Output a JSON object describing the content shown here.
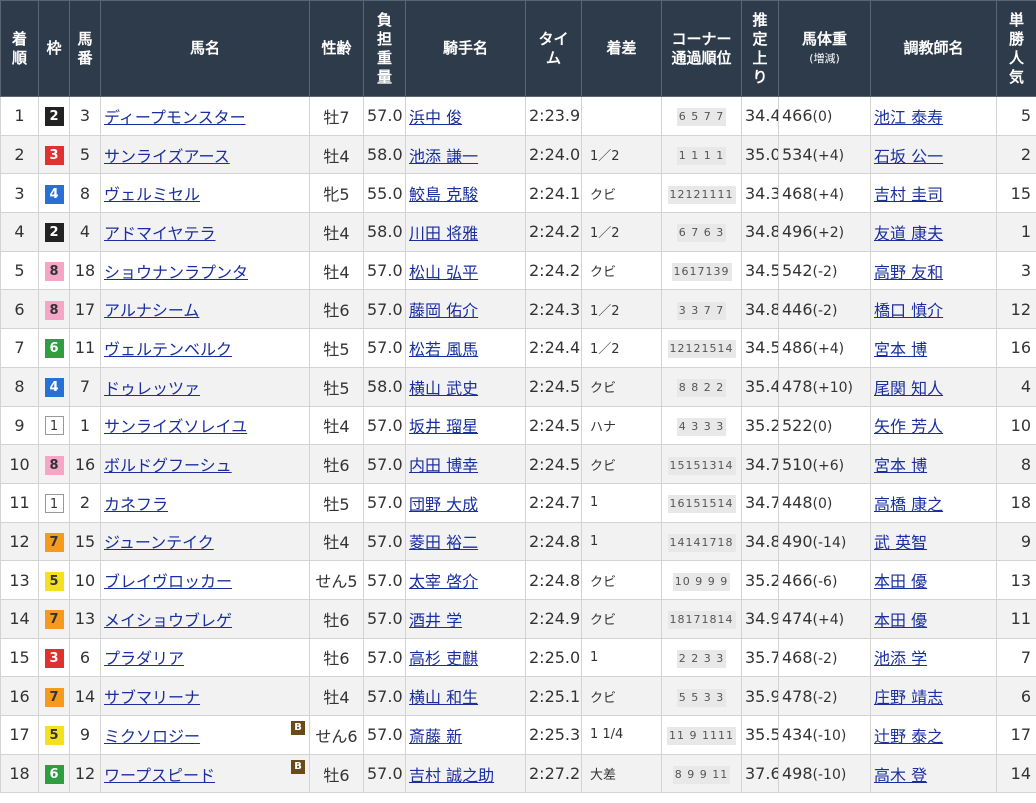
{
  "headers": {
    "rank": [
      "着",
      "順"
    ],
    "waku": "枠",
    "umaban": [
      "馬",
      "番"
    ],
    "horse": "馬名",
    "sexage": "性齢",
    "weight": [
      "負",
      "担",
      "重",
      "量"
    ],
    "jockey": "騎手名",
    "time": [
      "タイ",
      "ム"
    ],
    "margin": "着差",
    "corner": [
      "コーナー",
      "通過順位"
    ],
    "last3f": [
      "推",
      "定",
      "上",
      "り"
    ],
    "body": "馬体重",
    "body_sub": "(増減)",
    "trainer": "調教師名",
    "pop": [
      "単",
      "勝",
      "人",
      "気"
    ]
  },
  "colors": {
    "header_bg": "#2e3b4a",
    "link": "#1a2ea0",
    "waku": {
      "1": "#ffffff",
      "2": "#222222",
      "3": "#e03030",
      "4": "#2a6fd6",
      "5": "#f5e020",
      "6": "#2e9e40",
      "7": "#f59a1c",
      "8": "#f5a6c6"
    }
  },
  "rows": [
    {
      "rank": "1",
      "waku": "2",
      "umaban": "3",
      "horse": "ディープモンスター",
      "blinker": "",
      "sexage": "牡7",
      "weight": "57.0",
      "jockey": "浜中 俊",
      "time": "2:23.9",
      "margin": "",
      "corner": "6 5 7 7",
      "last3f": "34.4",
      "body": "466",
      "bdiff": "(0)",
      "trainer": "池江 泰寿",
      "pop": "5"
    },
    {
      "rank": "2",
      "waku": "3",
      "umaban": "5",
      "horse": "サンライズアース",
      "blinker": "",
      "sexage": "牡4",
      "weight": "58.0",
      "jockey": "池添 謙一",
      "time": "2:24.0",
      "margin": "1／2",
      "corner": "1 1 1 1",
      "last3f": "35.0",
      "body": "534",
      "bdiff": "(+4)",
      "trainer": "石坂 公一",
      "pop": "2"
    },
    {
      "rank": "3",
      "waku": "4",
      "umaban": "8",
      "horse": "ヴェルミセル",
      "blinker": "",
      "sexage": "牝5",
      "weight": "55.0",
      "jockey": "鮫島 克駿",
      "time": "2:24.1",
      "margin": "クビ",
      "corner": "12121111",
      "last3f": "34.3",
      "body": "468",
      "bdiff": "(+4)",
      "trainer": "吉村 圭司",
      "pop": "15"
    },
    {
      "rank": "4",
      "waku": "2",
      "umaban": "4",
      "horse": "アドマイヤテラ",
      "blinker": "",
      "sexage": "牡4",
      "weight": "58.0",
      "jockey": "川田 将雅",
      "time": "2:24.2",
      "margin": "1／2",
      "corner": "6 7 6 3",
      "last3f": "34.8",
      "body": "496",
      "bdiff": "(+2)",
      "trainer": "友道 康夫",
      "pop": "1"
    },
    {
      "rank": "5",
      "waku": "8",
      "umaban": "18",
      "horse": "ショウナンラプンタ",
      "blinker": "",
      "sexage": "牡4",
      "weight": "57.0",
      "jockey": "松山 弘平",
      "time": "2:24.2",
      "margin": "クビ",
      "corner": "1617139",
      "last3f": "34.5",
      "body": "542",
      "bdiff": "(-2)",
      "trainer": "高野 友和",
      "pop": "3"
    },
    {
      "rank": "6",
      "waku": "8",
      "umaban": "17",
      "horse": "アルナシーム",
      "blinker": "",
      "sexage": "牡6",
      "weight": "57.0",
      "jockey": "藤岡 佑介",
      "time": "2:24.3",
      "margin": "1／2",
      "corner": "3 3 7 7",
      "last3f": "34.8",
      "body": "446",
      "bdiff": "(-2)",
      "trainer": "橋口 慎介",
      "pop": "12"
    },
    {
      "rank": "7",
      "waku": "6",
      "umaban": "11",
      "horse": "ヴェルテンベルク",
      "blinker": "",
      "sexage": "牡5",
      "weight": "57.0",
      "jockey": "松若 風馬",
      "time": "2:24.4",
      "margin": "1／2",
      "corner": "12121514",
      "last3f": "34.5",
      "body": "486",
      "bdiff": "(+4)",
      "trainer": "宮本 博",
      "pop": "16"
    },
    {
      "rank": "8",
      "waku": "4",
      "umaban": "7",
      "horse": "ドゥレッツァ",
      "blinker": "",
      "sexage": "牡5",
      "weight": "58.0",
      "jockey": "横山 武史",
      "time": "2:24.5",
      "margin": "クビ",
      "corner": "8 8 2 2",
      "last3f": "35.4",
      "body": "478",
      "bdiff": "(+10)",
      "trainer": "尾関 知人",
      "pop": "4"
    },
    {
      "rank": "9",
      "waku": "1",
      "umaban": "1",
      "horse": "サンライズソレイユ",
      "blinker": "",
      "sexage": "牡4",
      "weight": "57.0",
      "jockey": "坂井 瑠星",
      "time": "2:24.5",
      "margin": "ハナ",
      "corner": "4 3 3 3",
      "last3f": "35.2",
      "body": "522",
      "bdiff": "(0)",
      "trainer": "矢作 芳人",
      "pop": "10"
    },
    {
      "rank": "10",
      "waku": "8",
      "umaban": "16",
      "horse": "ボルドグフーシュ",
      "blinker": "",
      "sexage": "牡6",
      "weight": "57.0",
      "jockey": "内田 博幸",
      "time": "2:24.5",
      "margin": "クビ",
      "corner": "15151314",
      "last3f": "34.7",
      "body": "510",
      "bdiff": "(+6)",
      "trainer": "宮本 博",
      "pop": "8"
    },
    {
      "rank": "11",
      "waku": "1",
      "umaban": "2",
      "horse": "カネフラ",
      "blinker": "",
      "sexage": "牡5",
      "weight": "57.0",
      "jockey": "団野 大成",
      "time": "2:24.7",
      "margin": "1",
      "corner": "16151514",
      "last3f": "34.7",
      "body": "448",
      "bdiff": "(0)",
      "trainer": "高橋 康之",
      "pop": "18"
    },
    {
      "rank": "12",
      "waku": "7",
      "umaban": "15",
      "horse": "ジューンテイク",
      "blinker": "",
      "sexage": "牡4",
      "weight": "57.0",
      "jockey": "菱田 裕二",
      "time": "2:24.8",
      "margin": "1",
      "corner": "14141718",
      "last3f": "34.8",
      "body": "490",
      "bdiff": "(-14)",
      "trainer": "武 英智",
      "pop": "9"
    },
    {
      "rank": "13",
      "waku": "5",
      "umaban": "10",
      "horse": "ブレイヴロッカー",
      "blinker": "",
      "sexage": "せん5",
      "weight": "57.0",
      "jockey": "太宰 啓介",
      "time": "2:24.8",
      "margin": "クビ",
      "corner": "10 9 9 9",
      "last3f": "35.2",
      "body": "466",
      "bdiff": "(-6)",
      "trainer": "本田 優",
      "pop": "13"
    },
    {
      "rank": "14",
      "waku": "7",
      "umaban": "13",
      "horse": "メイショウブレゲ",
      "blinker": "",
      "sexage": "牡6",
      "weight": "57.0",
      "jockey": "酒井 学",
      "time": "2:24.9",
      "margin": "クビ",
      "corner": "18171814",
      "last3f": "34.9",
      "body": "474",
      "bdiff": "(+4)",
      "trainer": "本田 優",
      "pop": "11"
    },
    {
      "rank": "15",
      "waku": "3",
      "umaban": "6",
      "horse": "プラダリア",
      "blinker": "",
      "sexage": "牡6",
      "weight": "57.0",
      "jockey": "高杉 吏麒",
      "time": "2:25.0",
      "margin": "1",
      "corner": "2 2 3 3",
      "last3f": "35.7",
      "body": "468",
      "bdiff": "(-2)",
      "trainer": "池添 学",
      "pop": "7"
    },
    {
      "rank": "16",
      "waku": "7",
      "umaban": "14",
      "horse": "サブマリーナ",
      "blinker": "",
      "sexage": "牡4",
      "weight": "57.0",
      "jockey": "横山 和生",
      "time": "2:25.1",
      "margin": "クビ",
      "corner": "5 5 3 3",
      "last3f": "35.9",
      "body": "478",
      "bdiff": "(-2)",
      "trainer": "庄野 靖志",
      "pop": "6"
    },
    {
      "rank": "17",
      "waku": "5",
      "umaban": "9",
      "horse": "ミクソロジー",
      "blinker": "B",
      "sexage": "せん6",
      "weight": "57.0",
      "jockey": "斎藤 新",
      "time": "2:25.3",
      "margin": "1 1/4",
      "corner": "11 9 1111",
      "last3f": "35.5",
      "body": "434",
      "bdiff": "(-10)",
      "trainer": "辻野 泰之",
      "pop": "17"
    },
    {
      "rank": "18",
      "waku": "6",
      "umaban": "12",
      "horse": "ワープスピード",
      "blinker": "B",
      "sexage": "牡6",
      "weight": "57.0",
      "jockey": "吉村 誠之助",
      "time": "2:27.2",
      "margin": "大差",
      "corner": "8 9 9 11",
      "last3f": "37.6",
      "body": "498",
      "bdiff": "(-10)",
      "trainer": "高木 登",
      "pop": "14"
    }
  ]
}
